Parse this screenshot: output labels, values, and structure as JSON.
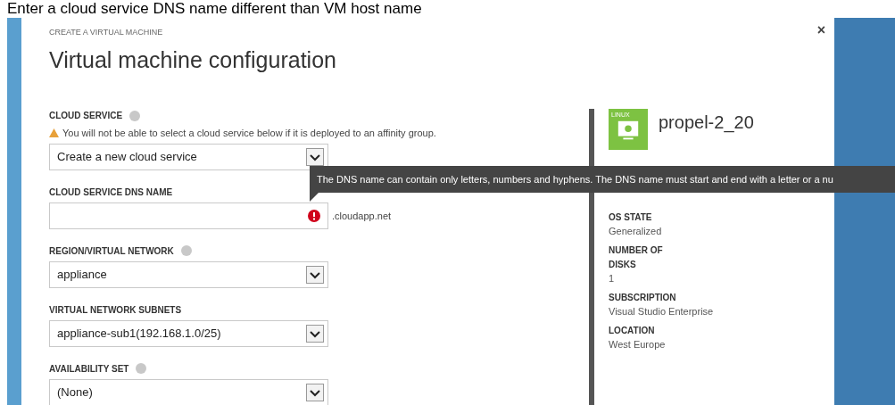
{
  "caption": "Enter a cloud service DNS name different than VM host name",
  "dialog": {
    "step": "CREATE A VIRTUAL MACHINE",
    "title": "Virtual machine configuration",
    "close": "×"
  },
  "fields": [
    {
      "kind": "select",
      "label": "CLOUD SERVICE",
      "help": true,
      "warning": "You will not be able to select a cloud service below if it is deployed to an affinity group.",
      "value": "Create a new cloud service"
    },
    {
      "kind": "text",
      "label": "CLOUD SERVICE DNS NAME",
      "error": true,
      "suffix": ".cloudapp.net"
    },
    {
      "kind": "select",
      "label": "REGION/VIRTUAL NETWORK",
      "help": true,
      "value": "appliance"
    },
    {
      "kind": "select",
      "label": "VIRTUAL NETWORK SUBNETS",
      "value": "appliance-sub1(192.168.1.0/25)"
    },
    {
      "kind": "select",
      "label": "AVAILABILITY SET",
      "help": true,
      "value": "(None)"
    }
  ],
  "tooltip": "The DNS name can contain only letters, numbers and hyphens. The DNS name must start and end with a letter or a nu",
  "summary": {
    "badge": "LINUX",
    "name": "propel-2_20",
    "details": [
      {
        "label": "OS STATE",
        "value": "Generalized"
      },
      {
        "label": "NUMBER OF DISKS",
        "value": "1"
      },
      {
        "label": "SUBSCRIPTION",
        "value": "Visual Studio Enterprise"
      },
      {
        "label": "LOCATION",
        "value": "West Europe"
      }
    ]
  }
}
